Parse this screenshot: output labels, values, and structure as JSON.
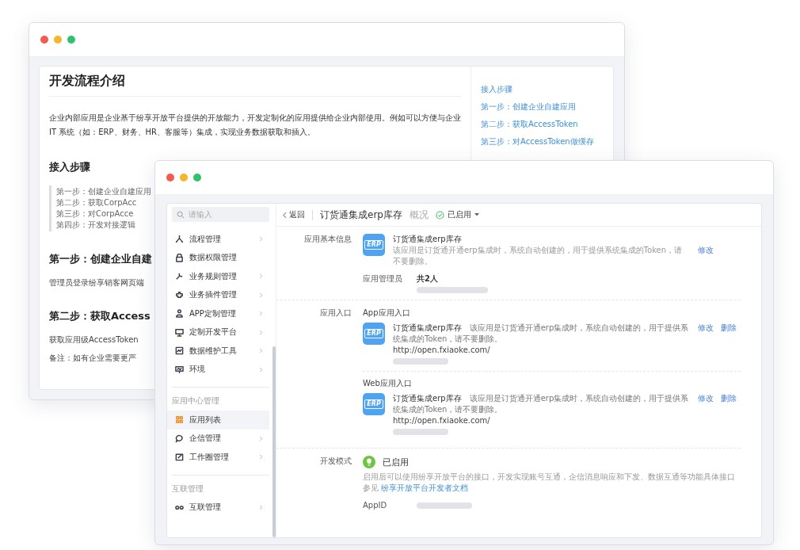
{
  "back_window": {
    "title": "开发流程介绍",
    "intro": "企业内部应用是企业基于纷享开放平台提供的开放能力，开发定制化的应用提供给企业内部使用。例如可以方便与企业 IT 系统（如：ERP、财务、HR、客服等）集成，实现业务数据获取和插入。",
    "blocks": [
      {
        "kind": "heading",
        "text": "接入步骤"
      },
      {
        "kind": "steps",
        "items": [
          "第一步：创建企业自建应用",
          "第二步：获取CorpAcc",
          "第三步：对CorpAcce",
          "第四步：开发对接逻辑"
        ]
      },
      {
        "kind": "heading",
        "text": "第一步：创建企业自建"
      },
      {
        "kind": "paragraph",
        "text": "管理员登录纷享销客网页端"
      },
      {
        "kind": "heading",
        "text": "第二步：获取Access"
      },
      {
        "kind": "paragraph",
        "text": "获取应用级AccessToken"
      },
      {
        "kind": "paragraph",
        "text": "备注：如有企业需要更严"
      }
    ],
    "toc": [
      "接入步骤",
      "第一步：创建企业自建应用",
      "第二步：获取AccessToken",
      "第三步：对AccessToken做缓存"
    ]
  },
  "front_window": {
    "sidebar": {
      "search": {
        "placeholder": "请输入"
      },
      "groups": [
        {
          "items": [
            {
              "label": "流程管理",
              "has_children": true,
              "selected": false
            },
            {
              "label": "数据权限管理",
              "has_children": false,
              "selected": false
            },
            {
              "label": "业务规则管理",
              "has_children": true,
              "selected": false
            },
            {
              "label": "业务插件管理",
              "has_children": true,
              "selected": false
            },
            {
              "label": "APP定制管理",
              "has_children": true,
              "selected": false
            },
            {
              "label": "定制开发平台",
              "has_children": true,
              "selected": false
            },
            {
              "label": "数据维护工具",
              "has_children": true,
              "selected": false
            },
            {
              "label": "环境",
              "has_children": true,
              "selected": false
            }
          ]
        },
        {
          "title": "应用中心管理",
          "items": [
            {
              "label": "应用列表",
              "has_children": false,
              "selected": true
            },
            {
              "label": "企信管理",
              "has_children": true,
              "selected": false
            },
            {
              "label": "工作圈管理",
              "has_children": true,
              "selected": false
            }
          ]
        },
        {
          "title": "互联管理",
          "items": [
            {
              "label": "互联管理",
              "has_children": true,
              "selected": false
            }
          ]
        }
      ]
    },
    "header": {
      "back": "返回",
      "title": "订货通集成erp库存",
      "tab": "概况",
      "status": {
        "label": "已启用",
        "enabled": true
      }
    },
    "sections": [
      {
        "kind": "basic",
        "label": "应用基本信息",
        "app": {
          "icon_label": "ERP",
          "name": "订货通集成erp库存",
          "description": "该应用是订货通开通erp集成时，系统自动创建的，用于提供系统集成的Token，请不要删除。"
        },
        "actions": [
          "修改"
        ],
        "admins": {
          "label": "应用管理员",
          "count": "共2人"
        }
      },
      {
        "kind": "entries",
        "label": "应用入口",
        "entries": [
          {
            "title": "App应用入口",
            "icon_label": "ERP",
            "name": "订货通集成erp库存",
            "description": "该应用是订货通开通erp集成时，系统自动创建的，用于提供系统集成的Token，请不要删除。",
            "url": "http://open.fxiaoke.com/",
            "actions": [
              "修改",
              "删除"
            ]
          },
          {
            "title": "Web应用入口",
            "icon_label": "ERP",
            "name": "订货通集成erp库存",
            "description": "该应用是订货通开通erp集成时，系统自动创建的，用于提供系统集成的Token，请不要删除。",
            "url": "http://open.fxiaoke.com/",
            "actions": [
              "修改",
              "删除"
            ]
          }
        ]
      },
      {
        "kind": "dev",
        "label": "开发模式",
        "status": "已启用",
        "enabled": true,
        "description": "启用后可以使用纷享开放平台的接口，开发实现账号互通，企信消息响应和下发、数据互通等功能具体接口参见",
        "link": "纷享开放平台开发者文档",
        "field": "AppID"
      }
    ]
  }
}
